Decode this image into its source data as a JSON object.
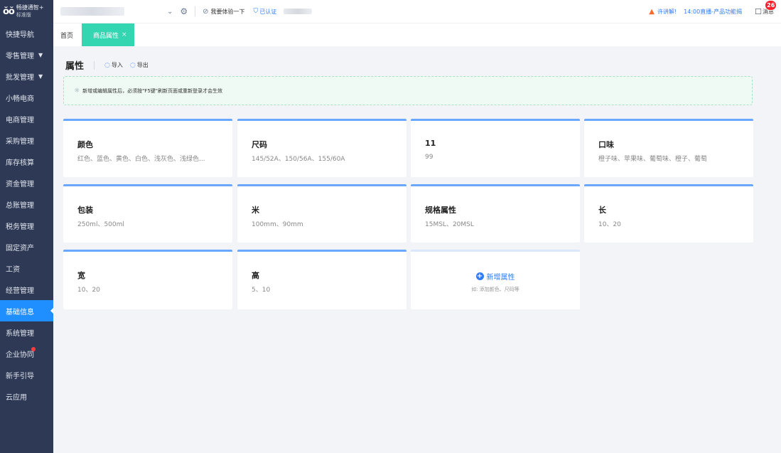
{
  "app": {
    "logo_mark": "ŏŏ",
    "name": "畅捷通智+",
    "subtitle": "标准版"
  },
  "sidebar": {
    "items": [
      {
        "label": "快捷导航",
        "caret": false,
        "active": false
      },
      {
        "label": "零售管理",
        "caret": true,
        "active": false
      },
      {
        "label": "批发管理",
        "caret": true,
        "active": false
      },
      {
        "label": "小畅电商",
        "caret": false,
        "active": false
      },
      {
        "label": "电商管理",
        "caret": false,
        "active": false
      },
      {
        "label": "采购管理",
        "caret": false,
        "active": false
      },
      {
        "label": "库存核算",
        "caret": false,
        "active": false
      },
      {
        "label": "资金管理",
        "caret": false,
        "active": false
      },
      {
        "label": "总账管理",
        "caret": false,
        "active": false
      },
      {
        "label": "税务管理",
        "caret": false,
        "active": false
      },
      {
        "label": "固定资产",
        "caret": false,
        "active": false
      },
      {
        "label": "工资",
        "caret": false,
        "active": false
      },
      {
        "label": "经营管理",
        "caret": false,
        "active": false
      },
      {
        "label": "基础信息",
        "caret": false,
        "active": true
      },
      {
        "label": "系统管理",
        "caret": false,
        "active": false
      },
      {
        "label": "企业协同",
        "caret": false,
        "active": false,
        "dot": true
      },
      {
        "label": "新手引导",
        "caret": false,
        "active": false
      },
      {
        "label": "云应用",
        "caret": false,
        "active": false
      }
    ]
  },
  "topbar": {
    "experience_label": "我要体验一下",
    "certified_label": "已认证",
    "announcement": "许讲解!",
    "live": "14:00直播-产品功能揭",
    "message_label": "消息",
    "message_count": "26",
    "icons": {
      "chevron": "chevron-down-icon",
      "gear": "gear-icon",
      "bell": "bell-icon",
      "message": "message-icon"
    }
  },
  "tabs": {
    "home": "首页",
    "active": "商品属性",
    "close_glyph": "×"
  },
  "page": {
    "title": "属性",
    "import_label": "导入",
    "export_label": "导出",
    "notice": "新增或编辑属性后，必须按\"F5键\"刷新页面或重新登录才会生效"
  },
  "attributes": [
    {
      "name": "颜色",
      "values": "红色、蓝色、黄色、白色、浅灰色、浅绿色..."
    },
    {
      "name": "尺码",
      "values": "145/52A、150/56A、155/60A"
    },
    {
      "name": "11",
      "values": "99"
    },
    {
      "name": "口味",
      "values": "橙子味、苹果味、葡萄味、橙子、葡萄"
    },
    {
      "name": "包装",
      "values": "250ml、500ml"
    },
    {
      "name": "米",
      "values": "100mm、90mm"
    },
    {
      "name": "规格属性",
      "values": "15MSL、20MSL"
    },
    {
      "name": "长",
      "values": "10、20"
    },
    {
      "name": "宽",
      "values": "10、20"
    },
    {
      "name": "高",
      "values": "5、10"
    }
  ],
  "add_card": {
    "label": "新增属性",
    "hint": "如: 添加颜色、尺码等"
  },
  "colors": {
    "sidebar_bg": "#2e3a55",
    "active_nav": "#1f8fff",
    "active_tab": "#34d6b1",
    "card_accent": "#6aa8ff",
    "link_blue": "#2f7cf6",
    "badge_red": "#f5222d"
  }
}
